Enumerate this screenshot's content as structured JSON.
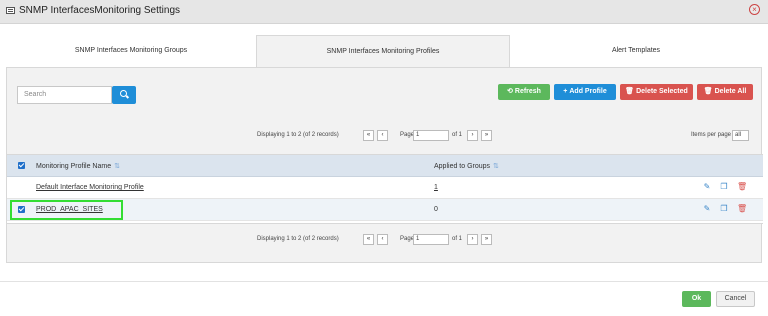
{
  "window": {
    "title": "SNMP InterfacesMonitoring Settings"
  },
  "tabs": [
    {
      "label": "SNMP Interfaces Monitoring Groups"
    },
    {
      "label": "SNMP Interfaces Monitoring Profiles",
      "active": true
    },
    {
      "label": "Alert Templates"
    }
  ],
  "search": {
    "placeholder": "Search",
    "value": ""
  },
  "toolbar": {
    "refresh_label": "Refresh",
    "add_label": "Add Profile",
    "delete_selected_label": "Delete Selected",
    "delete_all_label": "Delete All"
  },
  "pager": {
    "displaying": "Displaying 1 to 2 (of 2 records)",
    "first": "«",
    "prev": "‹",
    "page_label": "Page",
    "page_value": "1",
    "of_label": "of 1",
    "next": "›",
    "last": "»",
    "items_per_page_label": "Items per page",
    "items_per_page_value": "all"
  },
  "table": {
    "columns": {
      "name": "Monitoring Profile Name",
      "groups": "Applied to Groups"
    },
    "rows": [
      {
        "name": "Default Interface Monitoring Profile",
        "groups": "1",
        "checked": false
      },
      {
        "name": "PROD_APAC_SITES",
        "groups": "0",
        "checked": true
      }
    ]
  },
  "icons": {
    "sort": "sort-icon",
    "edit": "edit-icon",
    "copy": "copy-icon",
    "delete": "trash-icon"
  },
  "footer": {
    "ok_label": "Ok",
    "cancel_label": "Cancel"
  },
  "colors": {
    "accent": "#1f8ed8",
    "success": "#5cb85c",
    "danger": "#d9534f",
    "highlight": "#33dd33"
  }
}
